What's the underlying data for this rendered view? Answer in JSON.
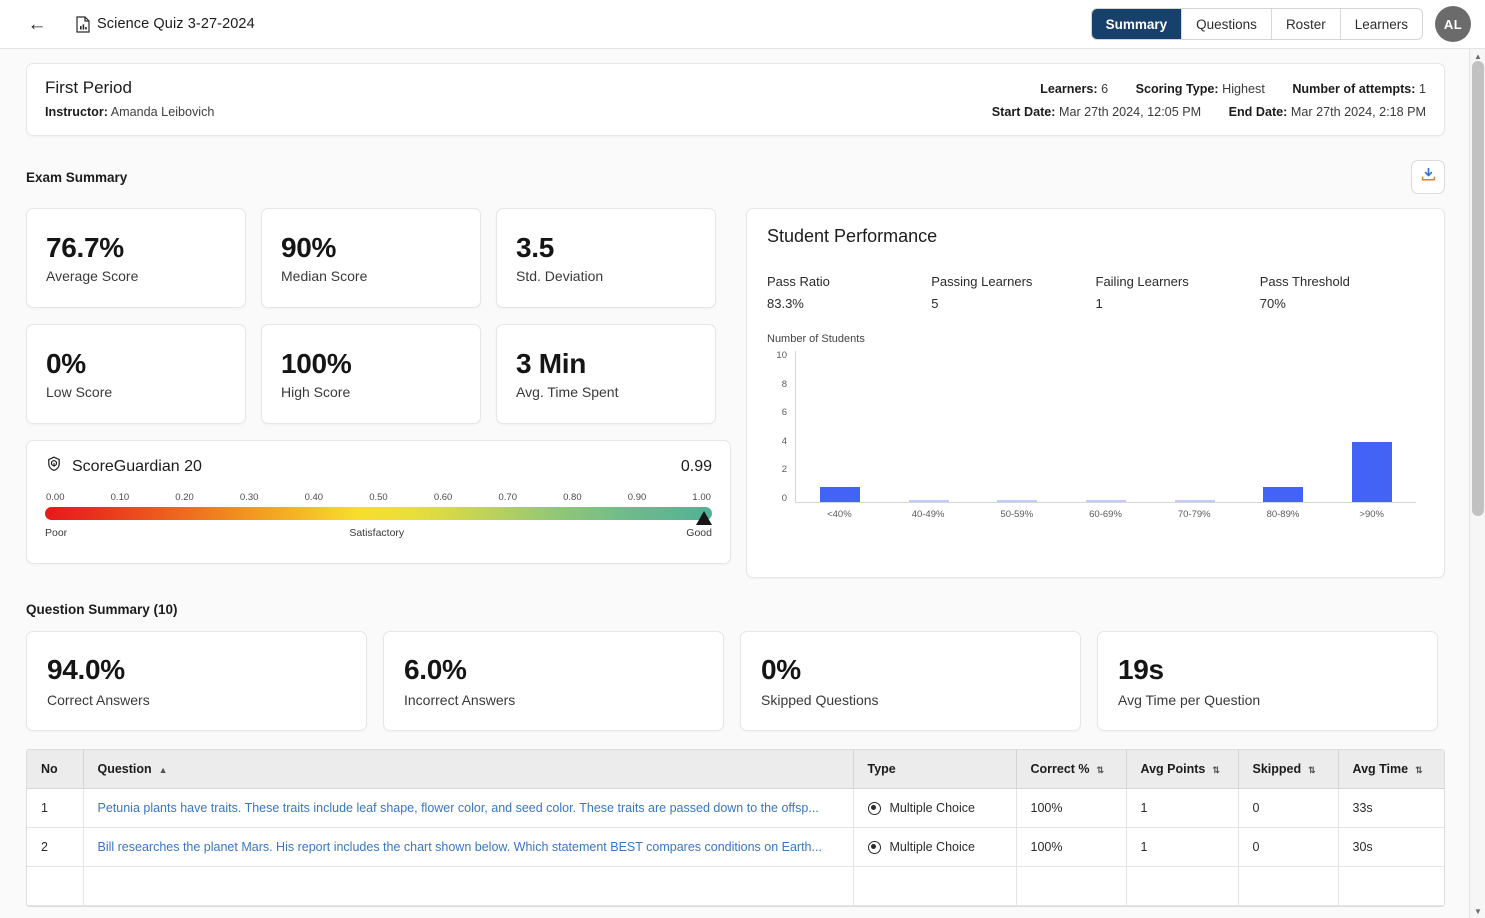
{
  "header": {
    "back_icon": "arrow-left-icon",
    "doc_icon": "document-chart-icon",
    "title": "Science Quiz 3-27-2024",
    "tabs": [
      {
        "label": "Summary",
        "active": true
      },
      {
        "label": "Questions",
        "active": false
      },
      {
        "label": "Roster",
        "active": false
      },
      {
        "label": "Learners",
        "active": false
      }
    ],
    "avatar_initials": "AL",
    "active_tab_color": "#17406b"
  },
  "info": {
    "period": "First Period",
    "instructor_label": "Instructor:",
    "instructor_name": "Amanda Leibovich",
    "learners_label": "Learners:",
    "learners_value": "6",
    "scoring_type_label": "Scoring Type:",
    "scoring_type_value": "Highest",
    "attempts_label": "Number of attempts:",
    "attempts_value": "1",
    "start_date_label": "Start Date:",
    "start_date_value": "Mar 27th 2024, 12:05 PM",
    "end_date_label": "End Date:",
    "end_date_value": "Mar 27th 2024, 2:18 PM"
  },
  "exam_summary": {
    "section_title": "Exam Summary",
    "download_icon": "download-icon",
    "stats": [
      {
        "value": "76.7%",
        "label": "Average Score"
      },
      {
        "value": "90%",
        "label": "Median Score"
      },
      {
        "value": "3.5",
        "label": "Std. Deviation"
      },
      {
        "value": "0%",
        "label": "Low Score"
      },
      {
        "value": "100%",
        "label": "High Score"
      },
      {
        "value": "3 Min",
        "label": "Avg. Time Spent"
      }
    ]
  },
  "score_guardian": {
    "icon": "shield-gauge-icon",
    "name": "ScoreGuardian 20",
    "score": "0.99",
    "ticks": [
      "0.00",
      "0.10",
      "0.20",
      "0.30",
      "0.40",
      "0.50",
      "0.60",
      "0.70",
      "0.80",
      "0.90",
      "1.00"
    ],
    "legend_low": "Poor",
    "legend_mid": "Satisfactory",
    "legend_high": "Good",
    "marker_position": 0.99
  },
  "student_performance": {
    "title": "Student Performance",
    "stats": [
      {
        "label": "Pass Ratio",
        "value": "83.3%"
      },
      {
        "label": "Passing Learners",
        "value": "5"
      },
      {
        "label": "Failing Learners",
        "value": "1"
      },
      {
        "label": "Pass Threshold",
        "value": "70%"
      }
    ]
  },
  "chart_data": {
    "type": "bar",
    "title": "Student Performance",
    "ylabel": "Number of Students",
    "xlabel": "",
    "categories": [
      "<40%",
      "40-49%",
      "50-59%",
      "60-69%",
      "70-79%",
      "80-89%",
      ">90%"
    ],
    "values": [
      1,
      0,
      0,
      0,
      0,
      1,
      4
    ],
    "ylim": [
      0,
      10
    ],
    "yticks": [
      10,
      8,
      6,
      4,
      2,
      0
    ],
    "bar_color": "#4263f5",
    "grid": false,
    "legend": "none"
  },
  "question_summary": {
    "section_title": "Question Summary (10)",
    "cards": [
      {
        "value": "94.0%",
        "label": "Correct Answers"
      },
      {
        "value": "6.0%",
        "label": "Incorrect Answers"
      },
      {
        "value": "0%",
        "label": "Skipped Questions"
      },
      {
        "value": "19s",
        "label": "Avg Time per Question"
      }
    ]
  },
  "question_table": {
    "columns": [
      {
        "label": "No",
        "sort": "none"
      },
      {
        "label": "Question",
        "sort": "asc"
      },
      {
        "label": "Type",
        "sort": "none"
      },
      {
        "label": "Correct %",
        "sort": "both"
      },
      {
        "label": "Avg Points",
        "sort": "both"
      },
      {
        "label": "Skipped",
        "sort": "both"
      },
      {
        "label": "Avg Time",
        "sort": "both"
      }
    ],
    "rows": [
      {
        "no": "1",
        "question": "Petunia plants have traits. These traits include leaf shape, flower color, and seed color. These traits are passed down to the offsp...",
        "type": "Multiple Choice",
        "correct_pct": "100%",
        "avg_points": "1",
        "skipped": "0",
        "avg_time": "33s"
      },
      {
        "no": "2",
        "question": "Bill researches the planet Mars. His report includes the chart shown below. Which statement BEST compares conditions on Earth...",
        "type": "Multiple Choice",
        "correct_pct": "100%",
        "avg_points": "1",
        "skipped": "0",
        "avg_time": "30s"
      }
    ]
  }
}
